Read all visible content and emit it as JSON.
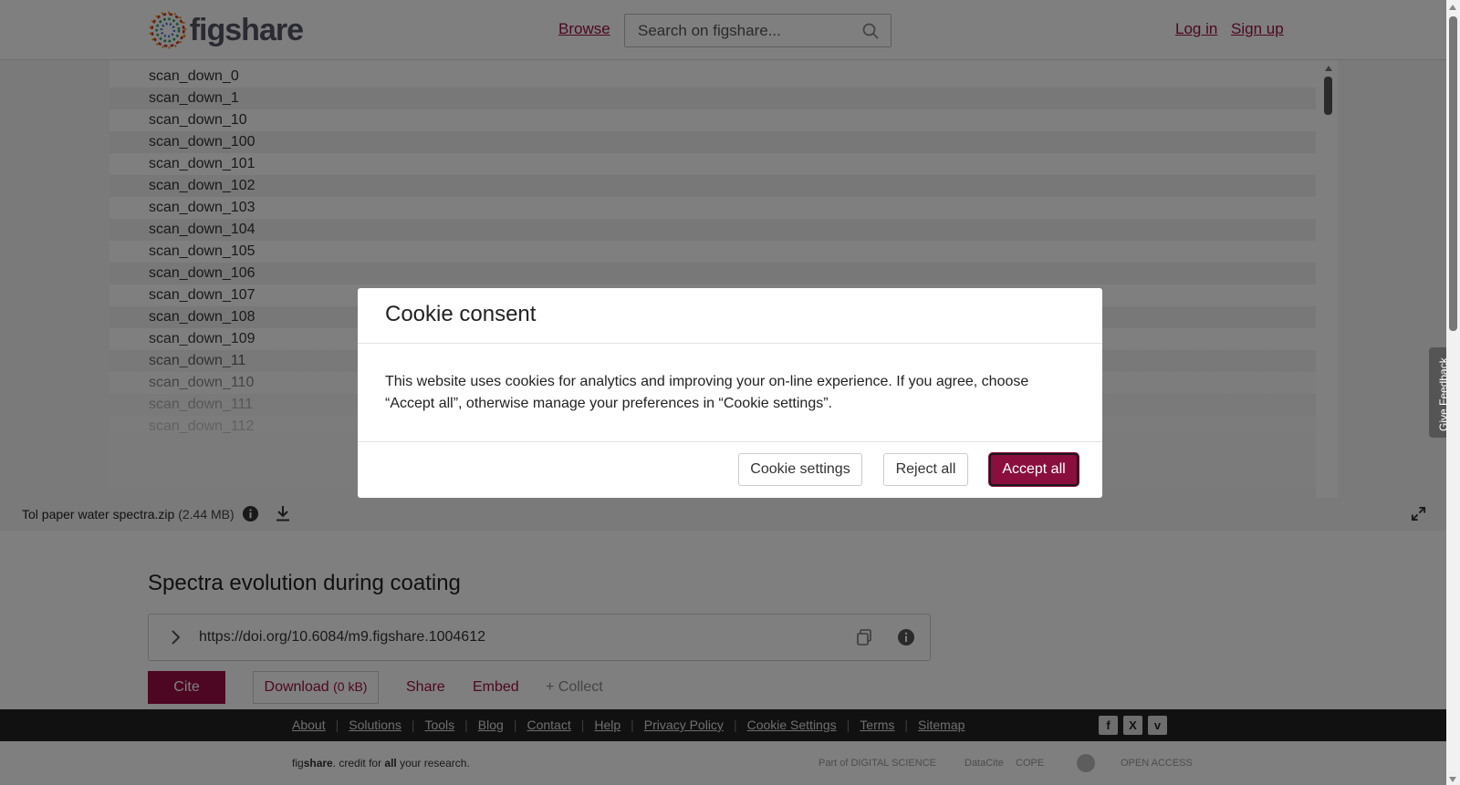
{
  "header": {
    "logo_text": "figshare",
    "browse": "Browse",
    "search_placeholder": "Search on figshare...",
    "login": "Log in",
    "signup": "Sign up"
  },
  "file_list": [
    "scan_down_0",
    "scan_down_1",
    "scan_down_10",
    "scan_down_100",
    "scan_down_101",
    "scan_down_102",
    "scan_down_103",
    "scan_down_104",
    "scan_down_105",
    "scan_down_106",
    "scan_down_107",
    "scan_down_108",
    "scan_down_109",
    "scan_down_11",
    "scan_down_110",
    "scan_down_111",
    "scan_down_112"
  ],
  "file_bar": {
    "name": "Tol paper water spectra.zip",
    "size": "(2.44 MB)"
  },
  "item": {
    "title": "Spectra evolution during coating",
    "doi": "https://doi.org/10.6084/m9.figshare.1004612",
    "cite": "Cite",
    "download": "Download",
    "download_size": "(0 kB)",
    "share": "Share",
    "embed": "Embed",
    "collect": "+ Collect"
  },
  "footer": {
    "links": [
      "About",
      "Solutions",
      "Tools",
      "Blog",
      "Contact",
      "Help",
      "Privacy Policy",
      "Cookie Settings",
      "Terms",
      "Sitemap"
    ],
    "tagline_pre": "fig",
    "tagline_bold": "share",
    "tagline_mid": ". credit for ",
    "tagline_all": "all",
    "tagline_post": " your research.",
    "partners": [
      "Part of DIGITAL SCIENCE",
      "DataCite",
      "COPE",
      "OPEN ACCESS"
    ]
  },
  "cookie_modal": {
    "title": "Cookie consent",
    "body": "This website uses cookies for analytics and improving your on-line experience. If you agree, choose “Accept all”, otherwise manage your preferences in “Cookie settings”.",
    "settings_btn": "Cookie settings",
    "reject_btn": "Reject all",
    "accept_btn": "Accept all"
  },
  "feedback": "Give Feedback",
  "colors": {
    "brand": "#9b0f44",
    "accept_button": "#8a0f3f",
    "footer_bg": "#222222"
  }
}
